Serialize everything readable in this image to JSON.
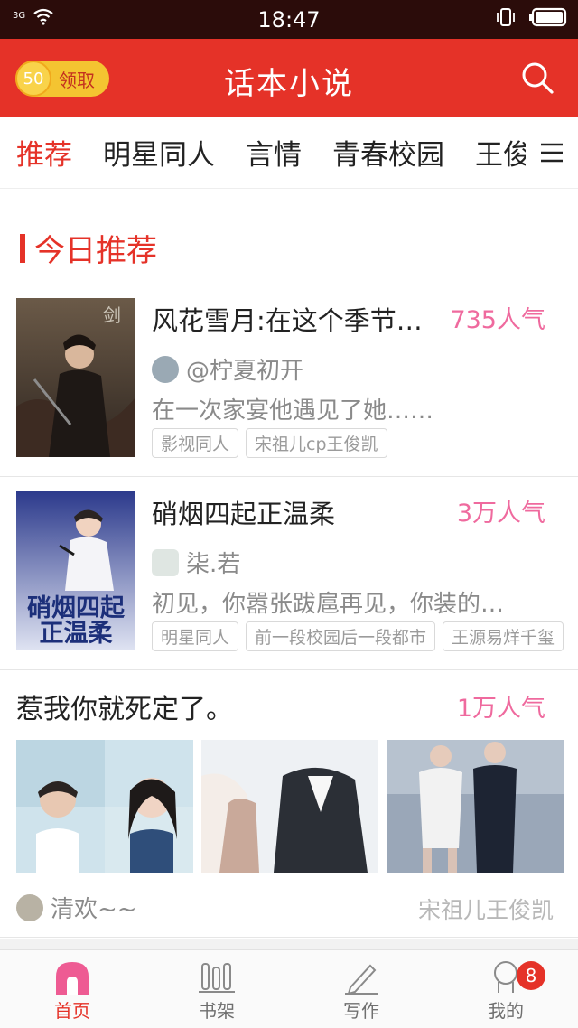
{
  "status_bar": {
    "time": "18:47",
    "network": "3G"
  },
  "app_bar": {
    "coin_value": "50",
    "coin_label": "领取",
    "title": "话本小说"
  },
  "tabs": [
    "推荐",
    "明星同人",
    "言情",
    "青春校园",
    "王俊"
  ],
  "section": {
    "title": "今日推荐"
  },
  "books": [
    {
      "title": "风花雪月:在这个季节…",
      "popularity": "735人气",
      "author": "@柠夏初开",
      "description": "在一次家宴他遇见了她……",
      "tags": [
        "影视同人",
        "宋祖儿cp王俊凯"
      ]
    },
    {
      "title": "硝烟四起正温柔",
      "popularity": "3万人气",
      "author": "柒.若",
      "description": "初见，你嚣张跋扈再见，你装的…",
      "tags": [
        "明星同人",
        "前一段校园后一段都市",
        "王源易烊千玺"
      ],
      "cover_text": "硝烟四起正温柔"
    }
  ],
  "feature": {
    "title": "惹我你就死定了。",
    "popularity": "1万人气",
    "author": "清欢~~",
    "tag_text": "宋祖儿王俊凯"
  },
  "bottom_nav": [
    {
      "label": "首页",
      "icon": "home-icon",
      "active": true
    },
    {
      "label": "书架",
      "icon": "bookshelf-icon",
      "active": false
    },
    {
      "label": "写作",
      "icon": "pen-icon",
      "active": false
    },
    {
      "label": "我的",
      "icon": "profile-icon",
      "active": false,
      "badge": "8"
    }
  ],
  "colors": {
    "brand_red": "#e53228",
    "popularity_pink": "#ef6a9e",
    "status_bar": "#2b0c0a"
  }
}
